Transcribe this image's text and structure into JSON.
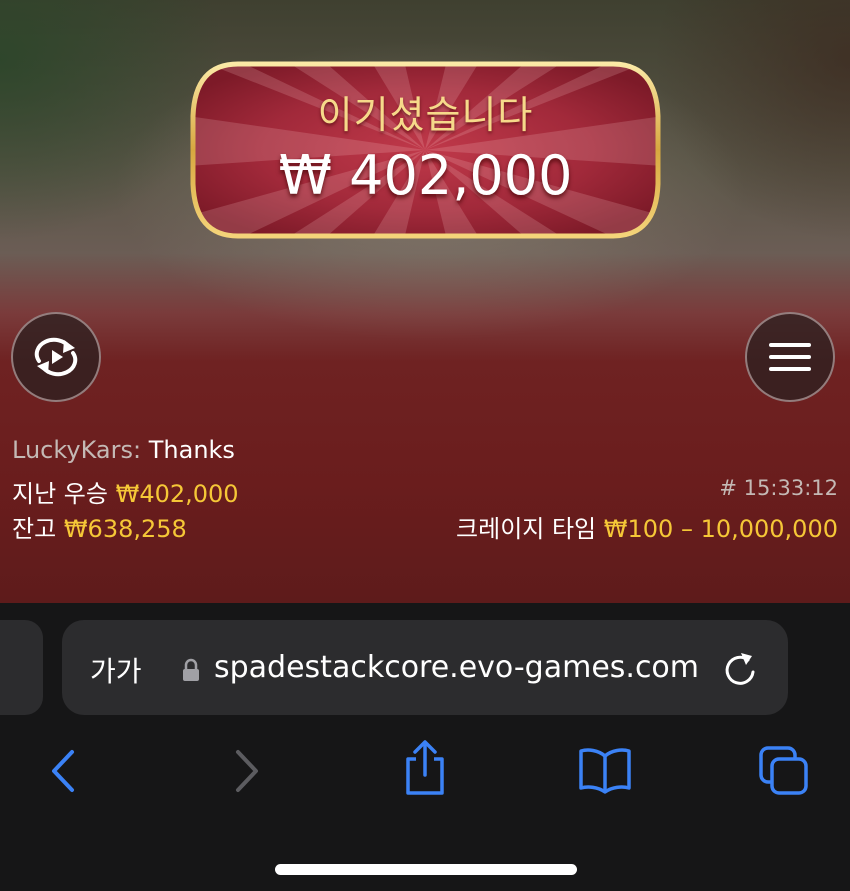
{
  "banner": {
    "title": "이기셨습니다",
    "amount": "₩ 402,000"
  },
  "controls": {
    "replay_icon": "replay-icon",
    "menu_icon": "hamburger-menu-icon"
  },
  "chat": {
    "user": "LuckyKars:",
    "message": "Thanks"
  },
  "stats": {
    "last_win_label": "지난 우승",
    "last_win_value": "₩402,000",
    "balance_label": "잔고",
    "balance_value": "₩638,258",
    "round_id": "# 15:33:12",
    "game_name": "크레이지 타임",
    "bet_limits": "₩100 – 10,000,000"
  },
  "browser": {
    "text_size_label": "가가",
    "url": "spadestackcore.evo-games.com",
    "toolbar": [
      "back-icon",
      "forward-icon",
      "share-icon",
      "bookmarks-icon",
      "tabs-icon"
    ],
    "accent_color": "#3b82f6"
  },
  "colors": {
    "gold": "#f5c737",
    "banner_red": "#9c2433"
  }
}
